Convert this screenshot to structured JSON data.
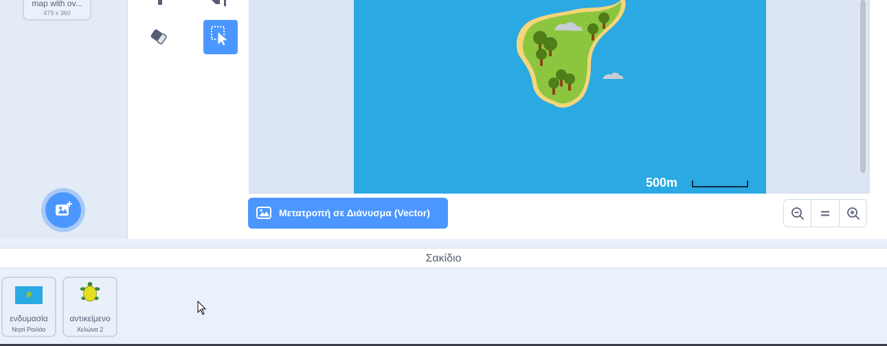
{
  "costume": {
    "name": "map with ov...",
    "size": "479 x 360"
  },
  "editor": {
    "convert_button_label": "Μετατροπή σε Διάνυσμα (Vector)",
    "scale_label": "500m"
  },
  "zoom": {
    "zoom_out": "zoom-out",
    "reset": "=",
    "zoom_in": "zoom-in"
  },
  "backpack": {
    "title": "Σακίδιο",
    "items": [
      {
        "title": "ενδυμασία",
        "subtitle": "Νησί Ροιλάο"
      },
      {
        "title": "αντικείμενο",
        "subtitle": "Χελώνα 2"
      }
    ]
  },
  "colors": {
    "accent": "#4c97ff",
    "sea": "#2ba9e3",
    "land": "#8cc63f",
    "sand": "#f5d67a",
    "tree": "#4e7d1a",
    "text": "#575e75"
  }
}
